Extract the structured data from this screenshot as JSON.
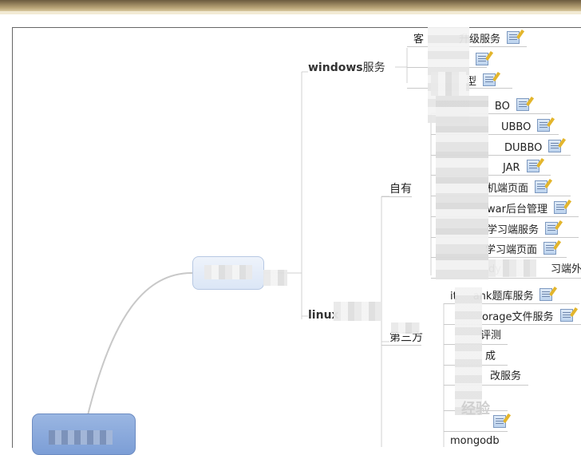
{
  "branches": {
    "windows": {
      "label_en": "windows",
      "label_cn": "服务"
    },
    "linux": {
      "label_en": "linux",
      "label_cn": ""
    }
  },
  "groups": {
    "self": "自有",
    "third": "第三方"
  },
  "windows_leaves": [
    "客",
    "升级服务",
    "型"
  ],
  "self_leaves": [
    "st",
    "BO",
    "UBBO",
    "DUBBO",
    "JAR",
    "机端页面",
    "war后台管理",
    "学习端服务",
    "学习端页面",
    "dy",
    "习端外壳"
  ],
  "third_leaves": [
    "it",
    "ank题库服务",
    "orage文件服务",
    "评测",
    "成",
    "改服务",
    "mongodb"
  ],
  "watermark": "经验"
}
